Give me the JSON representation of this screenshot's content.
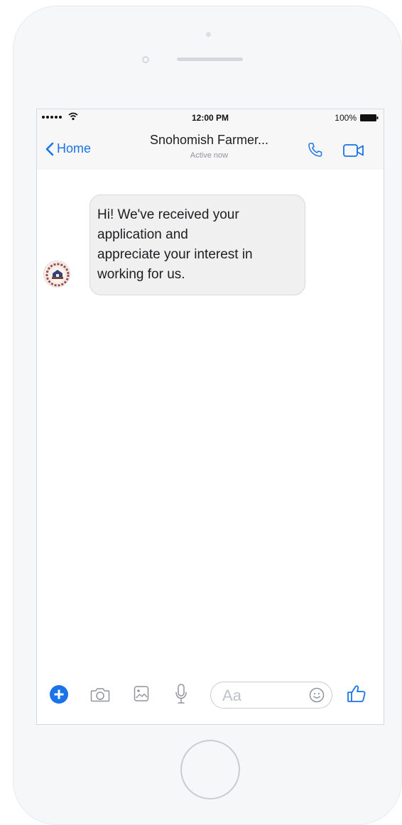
{
  "status_bar": {
    "time": "12:00 PM",
    "battery": "100%"
  },
  "header": {
    "back_label": "Home",
    "title": "Snohomish Farmer...",
    "subtitle": "Active now"
  },
  "conversation": {
    "messages": [
      {
        "from": "Snohomish Farmer...",
        "lines": [
          "Hi! We've received your",
          "application and",
          "appreciate your interest in",
          "working for us."
        ]
      }
    ]
  },
  "composer": {
    "placeholder": "Aa",
    "icons": [
      "plus-icon",
      "camera-icon",
      "image-icon",
      "microphone-icon",
      "emoji-icon",
      "thumbs-up-icon"
    ]
  },
  "colors": {
    "accent": "#1a73e8",
    "bubble": "#f1f0f0",
    "device": "#f6f7f9"
  }
}
